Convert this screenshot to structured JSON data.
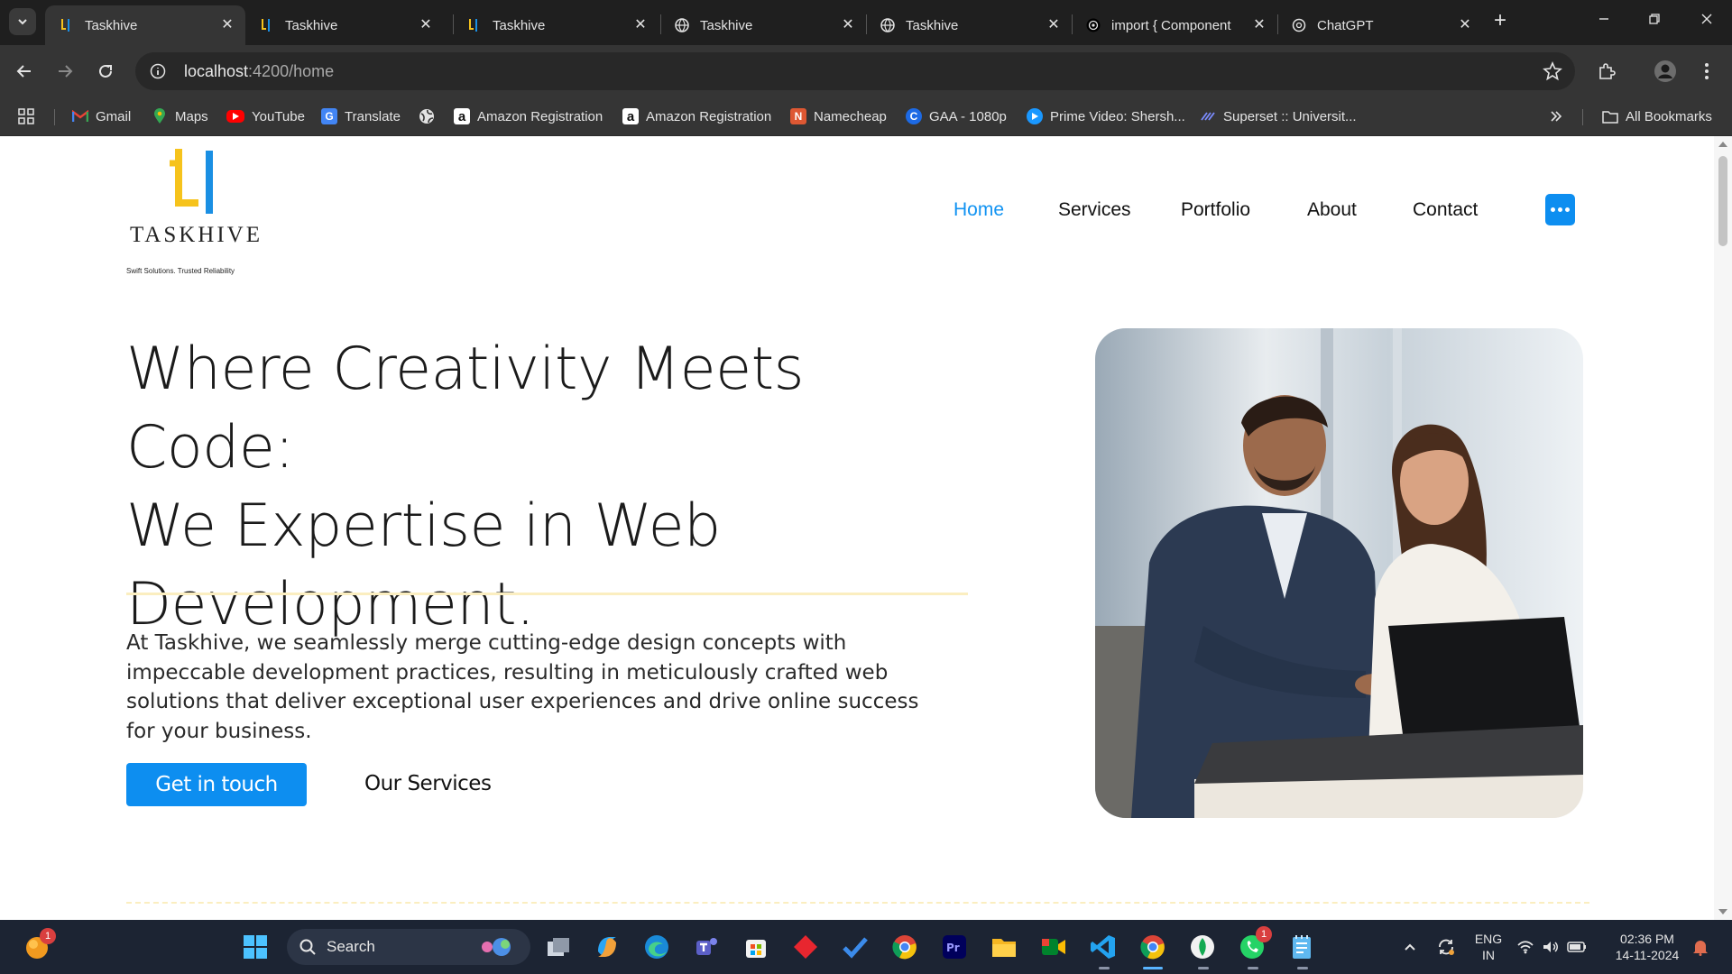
{
  "browser": {
    "tabs": [
      {
        "title": "Taskhive",
        "favicon": "taskhive-logo",
        "active": true
      },
      {
        "title": "Taskhive",
        "favicon": "taskhive-logo",
        "active": false
      },
      {
        "title": "Taskhive",
        "favicon": "taskhive-logo",
        "active": false
      },
      {
        "title": "Taskhive",
        "favicon": "globe",
        "active": false
      },
      {
        "title": "Taskhive",
        "favicon": "globe",
        "active": false
      },
      {
        "title": "import { Component",
        "favicon": "chatgpt-logo",
        "active": false
      },
      {
        "title": "ChatGPT",
        "favicon": "chatgpt-logo",
        "active": false
      }
    ],
    "url_host": "localhost",
    "url_path": ":4200/home",
    "bookmarks": [
      {
        "label": "Gmail",
        "icon": "gmail-icon"
      },
      {
        "label": "Maps",
        "icon": "maps-icon"
      },
      {
        "label": "YouTube",
        "icon": "youtube-icon"
      },
      {
        "label": "Translate",
        "icon": "translate-icon"
      },
      {
        "label": "",
        "icon": "globe-icon"
      },
      {
        "label": "Amazon Registration",
        "icon": "amazon-icon"
      },
      {
        "label": "Amazon Registration",
        "icon": "amazon-icon"
      },
      {
        "label": "Namecheap",
        "icon": "namecheap-icon"
      },
      {
        "label": "GAA - 1080p",
        "icon": "gaa-icon"
      },
      {
        "label": "Prime Video: Shersh...",
        "icon": "prime-video-icon"
      },
      {
        "label": "Superset :: Universit...",
        "icon": "superset-icon"
      }
    ],
    "all_bookmarks_label": "All Bookmarks"
  },
  "site": {
    "logo_text": "TASKHIVE",
    "logo_tagline": "Swift Solutions. Trusted Reliability",
    "nav": [
      {
        "label": "Home",
        "active": true
      },
      {
        "label": "Services",
        "active": false
      },
      {
        "label": "Portfolio",
        "active": false
      },
      {
        "label": "About",
        "active": false
      },
      {
        "label": "Contact",
        "active": false
      }
    ],
    "hero": {
      "heading_lines": [
        "Where Creativity Meets Code:",
        "We Expertise in Web",
        "Development."
      ],
      "body": "At Taskhive, we seamlessly merge cutting-edge design concepts with impeccable development practices, resulting in meticulously crafted web solutions that deliver exceptional user experiences and drive online success for your business.",
      "primary_button": "Get in touch",
      "secondary_button": "Our Services"
    }
  },
  "taskbar": {
    "search_label": "Search",
    "notification_badge": "1",
    "whatsapp_badge": "1",
    "language": "ENG",
    "region": "IN",
    "time": "02:36 PM",
    "date": "14-11-2024"
  },
  "colors": {
    "accent": "#0d8ef0",
    "logo_yellow": "#f6c31c",
    "logo_blue": "#1a8fe3",
    "rule": "#fbeec0"
  }
}
